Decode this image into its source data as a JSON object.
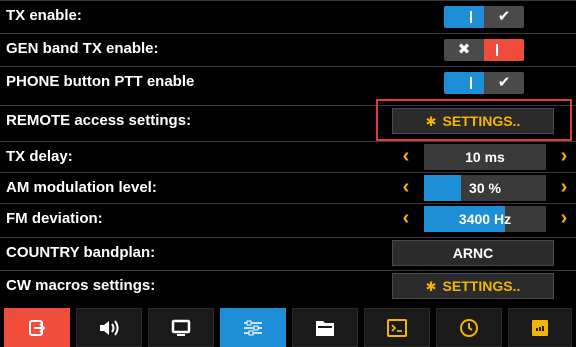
{
  "settings": {
    "tx_enable": {
      "label": "TX enable:",
      "state": "on",
      "on_glyph": "✔",
      "off_glyph": "✖"
    },
    "gen_band_tx_enable": {
      "label": "GEN band TX enable:",
      "state": "off",
      "on_glyph": "✔",
      "off_glyph": "✖"
    },
    "phone_ptt_enable": {
      "label": "PHONE button PTT enable",
      "state": "on",
      "on_glyph": "✔",
      "off_glyph": "✖"
    },
    "remote_access": {
      "label": "REMOTE access settings:",
      "button": "SETTINGS.."
    },
    "tx_delay": {
      "label": "TX delay:",
      "value": "10 ms",
      "level": 0
    },
    "am_modulation": {
      "label": "AM modulation level:",
      "value": "30 %",
      "level": 0.3
    },
    "fm_deviation": {
      "label": "FM deviation:",
      "value": "3400 Hz",
      "level": 0.66
    },
    "country_bandplan": {
      "label": "COUNTRY bandplan:",
      "value": "ARNC"
    },
    "cw_macros": {
      "label": "CW macros settings:",
      "button": "SETTINGS.."
    }
  },
  "nav": {
    "tabs": [
      {
        "name": "exit",
        "icon": "exit-icon",
        "active": true
      },
      {
        "name": "audio",
        "icon": "speaker-icon"
      },
      {
        "name": "display",
        "icon": "monitor-icon"
      },
      {
        "name": "settings",
        "icon": "sliders-icon",
        "selected": true
      },
      {
        "name": "files",
        "icon": "folder-icon"
      },
      {
        "name": "terminal",
        "icon": "terminal-icon"
      },
      {
        "name": "clock",
        "icon": "clock-icon"
      },
      {
        "name": "memory",
        "icon": "sd-card-icon"
      }
    ]
  },
  "colors": {
    "accent": "#f4b400",
    "blue": "#1e8fd6",
    "red": "#ef4c3c",
    "highlight": "#e53935"
  }
}
